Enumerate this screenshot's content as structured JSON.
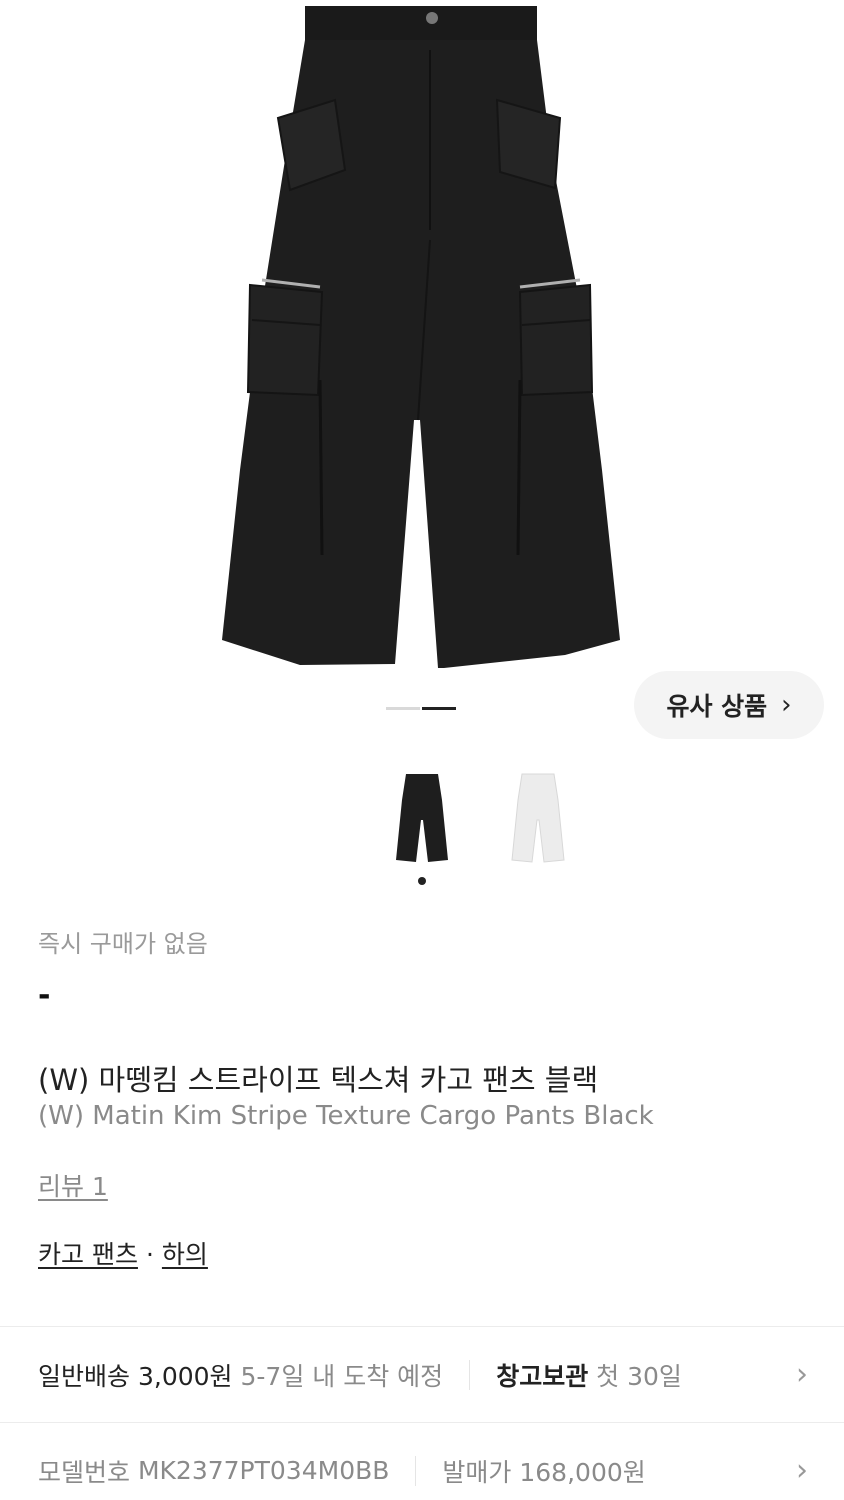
{
  "gallery": {
    "similar_button": "유사 상품",
    "similar_chevron": "›",
    "page_total": 2,
    "page_current": 2
  },
  "product": {
    "notice": "즉시 구매가 없음",
    "price": "-",
    "title_ko": "(W) 마뗑킴 스트라이프 텍스쳐 카고 팬츠 블랙",
    "title_en": "(W) Matin Kim Stripe Texture Cargo Pants Black",
    "reviews": "리뷰 1",
    "category_1": "카고 팬츠",
    "category_sep": "·",
    "category_2": "하의"
  },
  "shipping": {
    "label": "일반배송",
    "fee": "3,000원",
    "eta": "5-7일 내 도착 예정",
    "storage_label": "창고보관",
    "storage_text": "첫 30일",
    "chevron": "›"
  },
  "model": {
    "label": "모델번호",
    "number": "MK2377PT034M0BB",
    "release_label": "발매가",
    "release_price": "168,000원",
    "chevron": "›"
  },
  "colors": {
    "pants_black": "#1e1e1e",
    "pants_white": "#ececec",
    "accent": "#222222"
  }
}
